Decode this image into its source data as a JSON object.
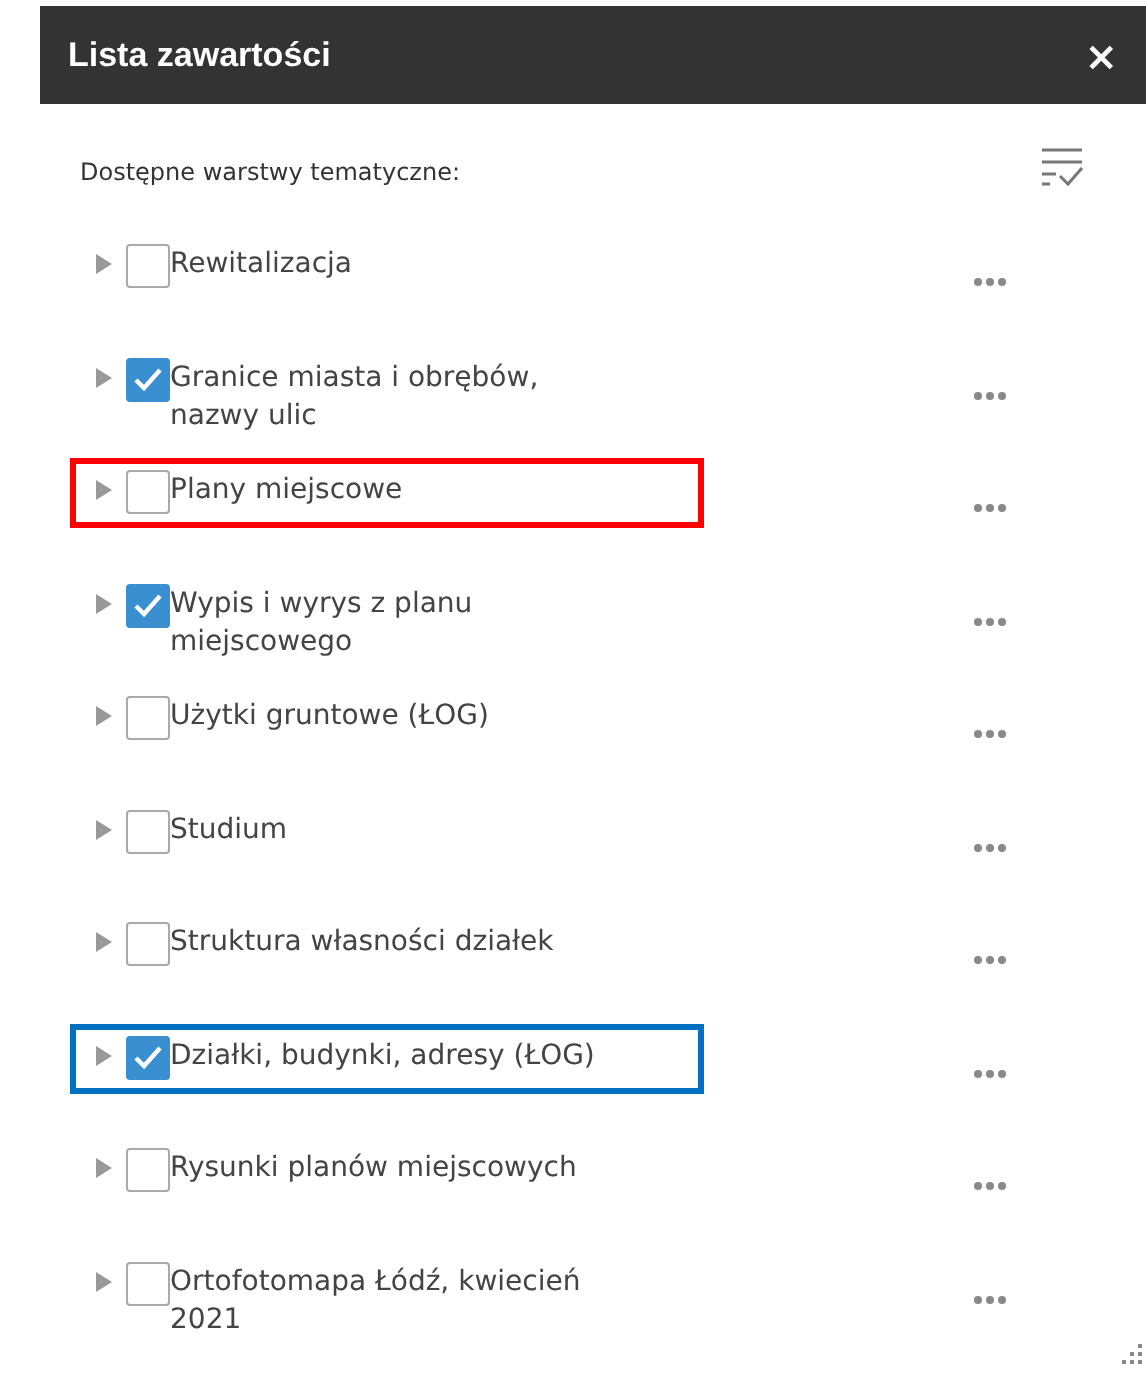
{
  "panel": {
    "title": "Lista zawartości",
    "close": "×"
  },
  "subtitle": "Dostępne warstwy tematyczne:",
  "layers": [
    {
      "label": "Rewitalizacja",
      "checked": false
    },
    {
      "label": "Granice miasta i obrębów, nazwy ulic",
      "checked": true
    },
    {
      "label": "Plany miejscowe",
      "checked": false,
      "color": "#ff0000"
    },
    {
      "label": "Wypis i wyrys z planu miejscowego",
      "checked": true
    },
    {
      "label": "Użytki gruntowe (ŁOG)",
      "checked": false
    },
    {
      "label": "Studium",
      "checked": false
    },
    {
      "label": "Struktura własności działek",
      "checked": false
    },
    {
      "label": "Działki, budynki, adresy (ŁOG)",
      "checked": true,
      "color": "#0070c0"
    },
    {
      "label": "Rysunki planów miejscowych",
      "checked": false
    },
    {
      "label": "Ortofotomapa Łódź, kwiecień 2021",
      "checked": false
    }
  ]
}
